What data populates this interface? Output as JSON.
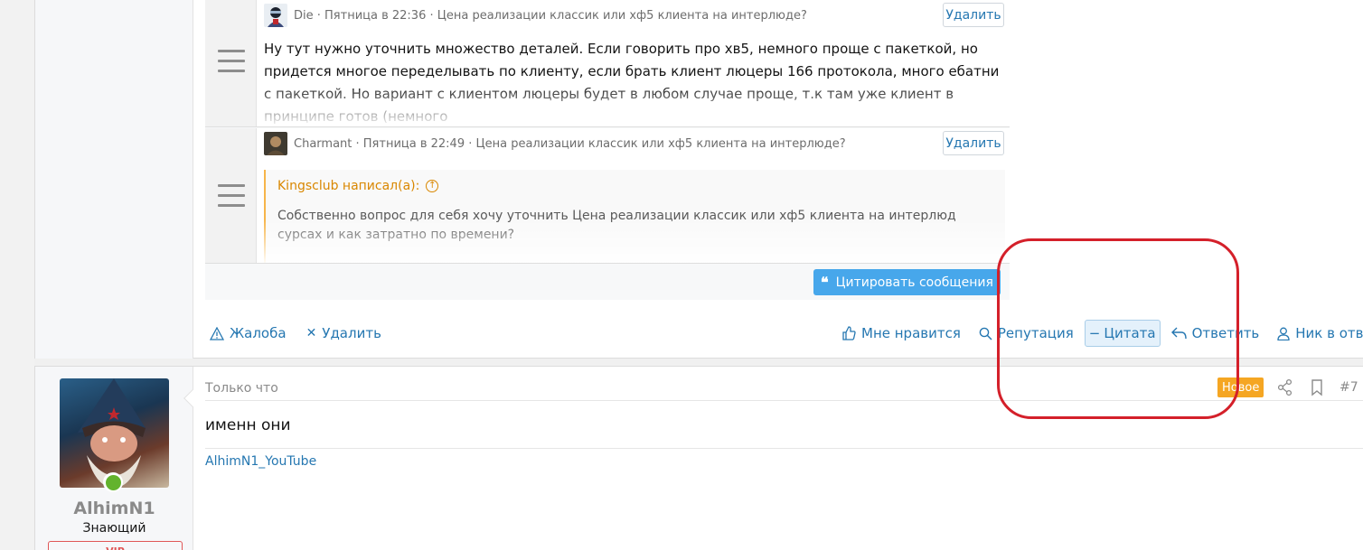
{
  "quotes": [
    {
      "author": "Die",
      "meta": "· Пятница в 22:36 · Цена реализации классик или хф5 клиента на интерлюде?",
      "delete_label": "Удалить",
      "text": "Ну тут нужно уточнить множество деталей. Если говорить про хв5, немного проще с пакеткой, но придется многое переделывать по клиенту, если брать клиент люцеры 166 протокола, много ебатни с пакеткой. Но вариант с клиентом люцеры будет в любом случае проще, т.к там уже клиент в принципе готов (немного"
    },
    {
      "author": "Charmant",
      "meta": "· Пятница в 22:49 · Цена реализации классик или хф5 клиента на интерлюде?",
      "delete_label": "Удалить",
      "quote_author": "Kingsclub написал(а):",
      "quote_text": "Собственно вопрос для себя хочу уточнить Цена реализации классик или хф5 клиента на интерлюд сурсах и как затратно по времени?"
    }
  ],
  "cite_button": "Цитировать сообщения",
  "actions_left": {
    "report": "Жалоба",
    "delete": "Удалить"
  },
  "actions_right": {
    "like": "Мне нравится",
    "reputation": "Репутация",
    "quote": "Цитата",
    "reply": "Ответить",
    "nick": "Ник в ответ"
  },
  "post2": {
    "user": {
      "name": "AlhimN1",
      "title": "Знающий",
      "banner": "VIP"
    },
    "time": "Только что",
    "badge": "Новое",
    "number": "#7",
    "message": "именн они",
    "signature": "AlhimN1_YouTube"
  }
}
